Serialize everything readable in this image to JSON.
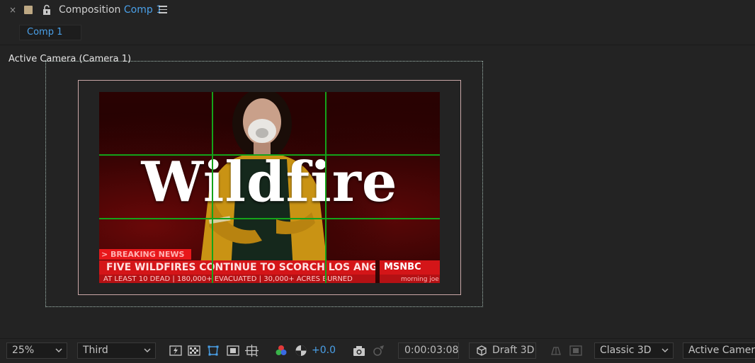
{
  "panel": {
    "close_glyph": "×",
    "label_color": "#bda883",
    "title_prefix": "Composition",
    "title_comp": "Comp 1",
    "menu_icon": "hamburger-menu-icon"
  },
  "tab": {
    "label": "Comp 1"
  },
  "viewer": {
    "view_label": "Active Camera (Camera 1)",
    "scene": {
      "headline": "Wildfire",
      "breaking": "> BREAKING NEWS",
      "ticker": "FIVE WILDFIRES CONTINUE TO SCORCH LOS ANGELES COUNTY",
      "ticker_sub": "AT LEAST 10 DEAD | 180,000+ EVACUATED | 30,000+ ACRES BURNED",
      "network": "MSNBC",
      "network_sub": "morning joe"
    }
  },
  "toolbar": {
    "zoom": "25%",
    "resolution": "Third",
    "exposure": "+0.0",
    "timecode": "0:00:03:08",
    "renderer_button": "Draft 3D",
    "renderer": "Classic 3D",
    "view": "Active Camer..."
  },
  "colors": {
    "accent_blue": "#4aa0e8",
    "grid_green": "#14a31a",
    "background": "#232323"
  }
}
